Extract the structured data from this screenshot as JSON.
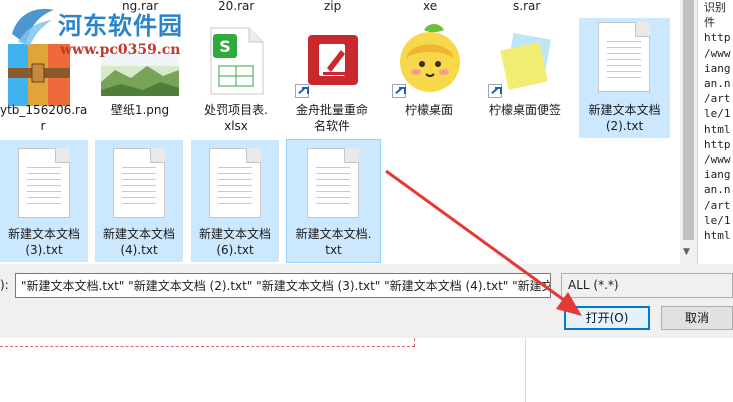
{
  "watermark": {
    "title": "河东软件园",
    "url": "www.pc0359.cn"
  },
  "top_labels": [
    "ng.rar",
    "20.rar",
    "zip",
    "xe",
    "s.rar"
  ],
  "files": [
    {
      "name": "ytb_156206.rar",
      "line1": "ytb_156206.ra",
      "line2": "r",
      "icon": "winrar-archive-icon",
      "selected": false
    },
    {
      "name": "壁纸1.png",
      "line1": "壁纸1.png",
      "line2": "",
      "icon": "image-thumbnail-icon",
      "selected": false
    },
    {
      "name": "处罚项目表.xlsx",
      "line1": "处罚项目表.",
      "line2": "xlsx",
      "icon": "spreadsheet-icon",
      "selected": false
    },
    {
      "name": "金舟批量重命名软件",
      "line1": "金舟批量重命",
      "line2": "名软件",
      "icon": "rename-app-icon",
      "selected": false
    },
    {
      "name": "柠檬桌面",
      "line1": "柠檬桌面",
      "line2": "",
      "icon": "lemon-desktop-icon",
      "selected": false
    },
    {
      "name": "柠檬桌面便签",
      "line1": "柠檬桌面便签",
      "line2": "",
      "icon": "sticky-note-icon",
      "selected": false
    },
    {
      "name": "新建文本文档(2).txt",
      "line1": "新建文本文档",
      "line2": "(2).txt",
      "icon": "text-file-icon",
      "selected": true
    },
    {
      "name": "新建文本文档(3).txt",
      "line1": "新建文本文档",
      "line2": "(3).txt",
      "icon": "text-file-icon",
      "selected": true
    },
    {
      "name": "新建文本文档(4).txt",
      "line1": "新建文本文档",
      "line2": "(4).txt",
      "icon": "text-file-icon",
      "selected": true
    },
    {
      "name": "新建文本文档(6).txt",
      "line1": "新建文本文档",
      "line2": "(6).txt",
      "icon": "text-file-icon",
      "selected": true
    },
    {
      "name": "新建文本文档.txt",
      "line1": "新建文本文档.",
      "line2": "txt",
      "icon": "text-file-icon",
      "selected": true
    }
  ],
  "right_pane_lines": [
    "识别",
    "件",
    "http",
    "/www",
    "iang",
    "an.n",
    "/art",
    "le/1",
    "html",
    "http",
    "/www",
    "iang",
    "an.n",
    "/art",
    "le/1",
    "html"
  ],
  "filename": {
    "label": "):",
    "value": "\"新建文本文档.txt\" \"新建文本文档 (2).txt\" \"新建文本文档 (3).txt\" \"新建文本文档 (4).txt\" \"新建文"
  },
  "filter": {
    "selected": "ALL (*.*)"
  },
  "buttons": {
    "open": "打开(O)",
    "cancel": "取消"
  },
  "colors": {
    "selection": "#cce8ff",
    "accent": "#0078d7",
    "arrow": "#e53935"
  }
}
